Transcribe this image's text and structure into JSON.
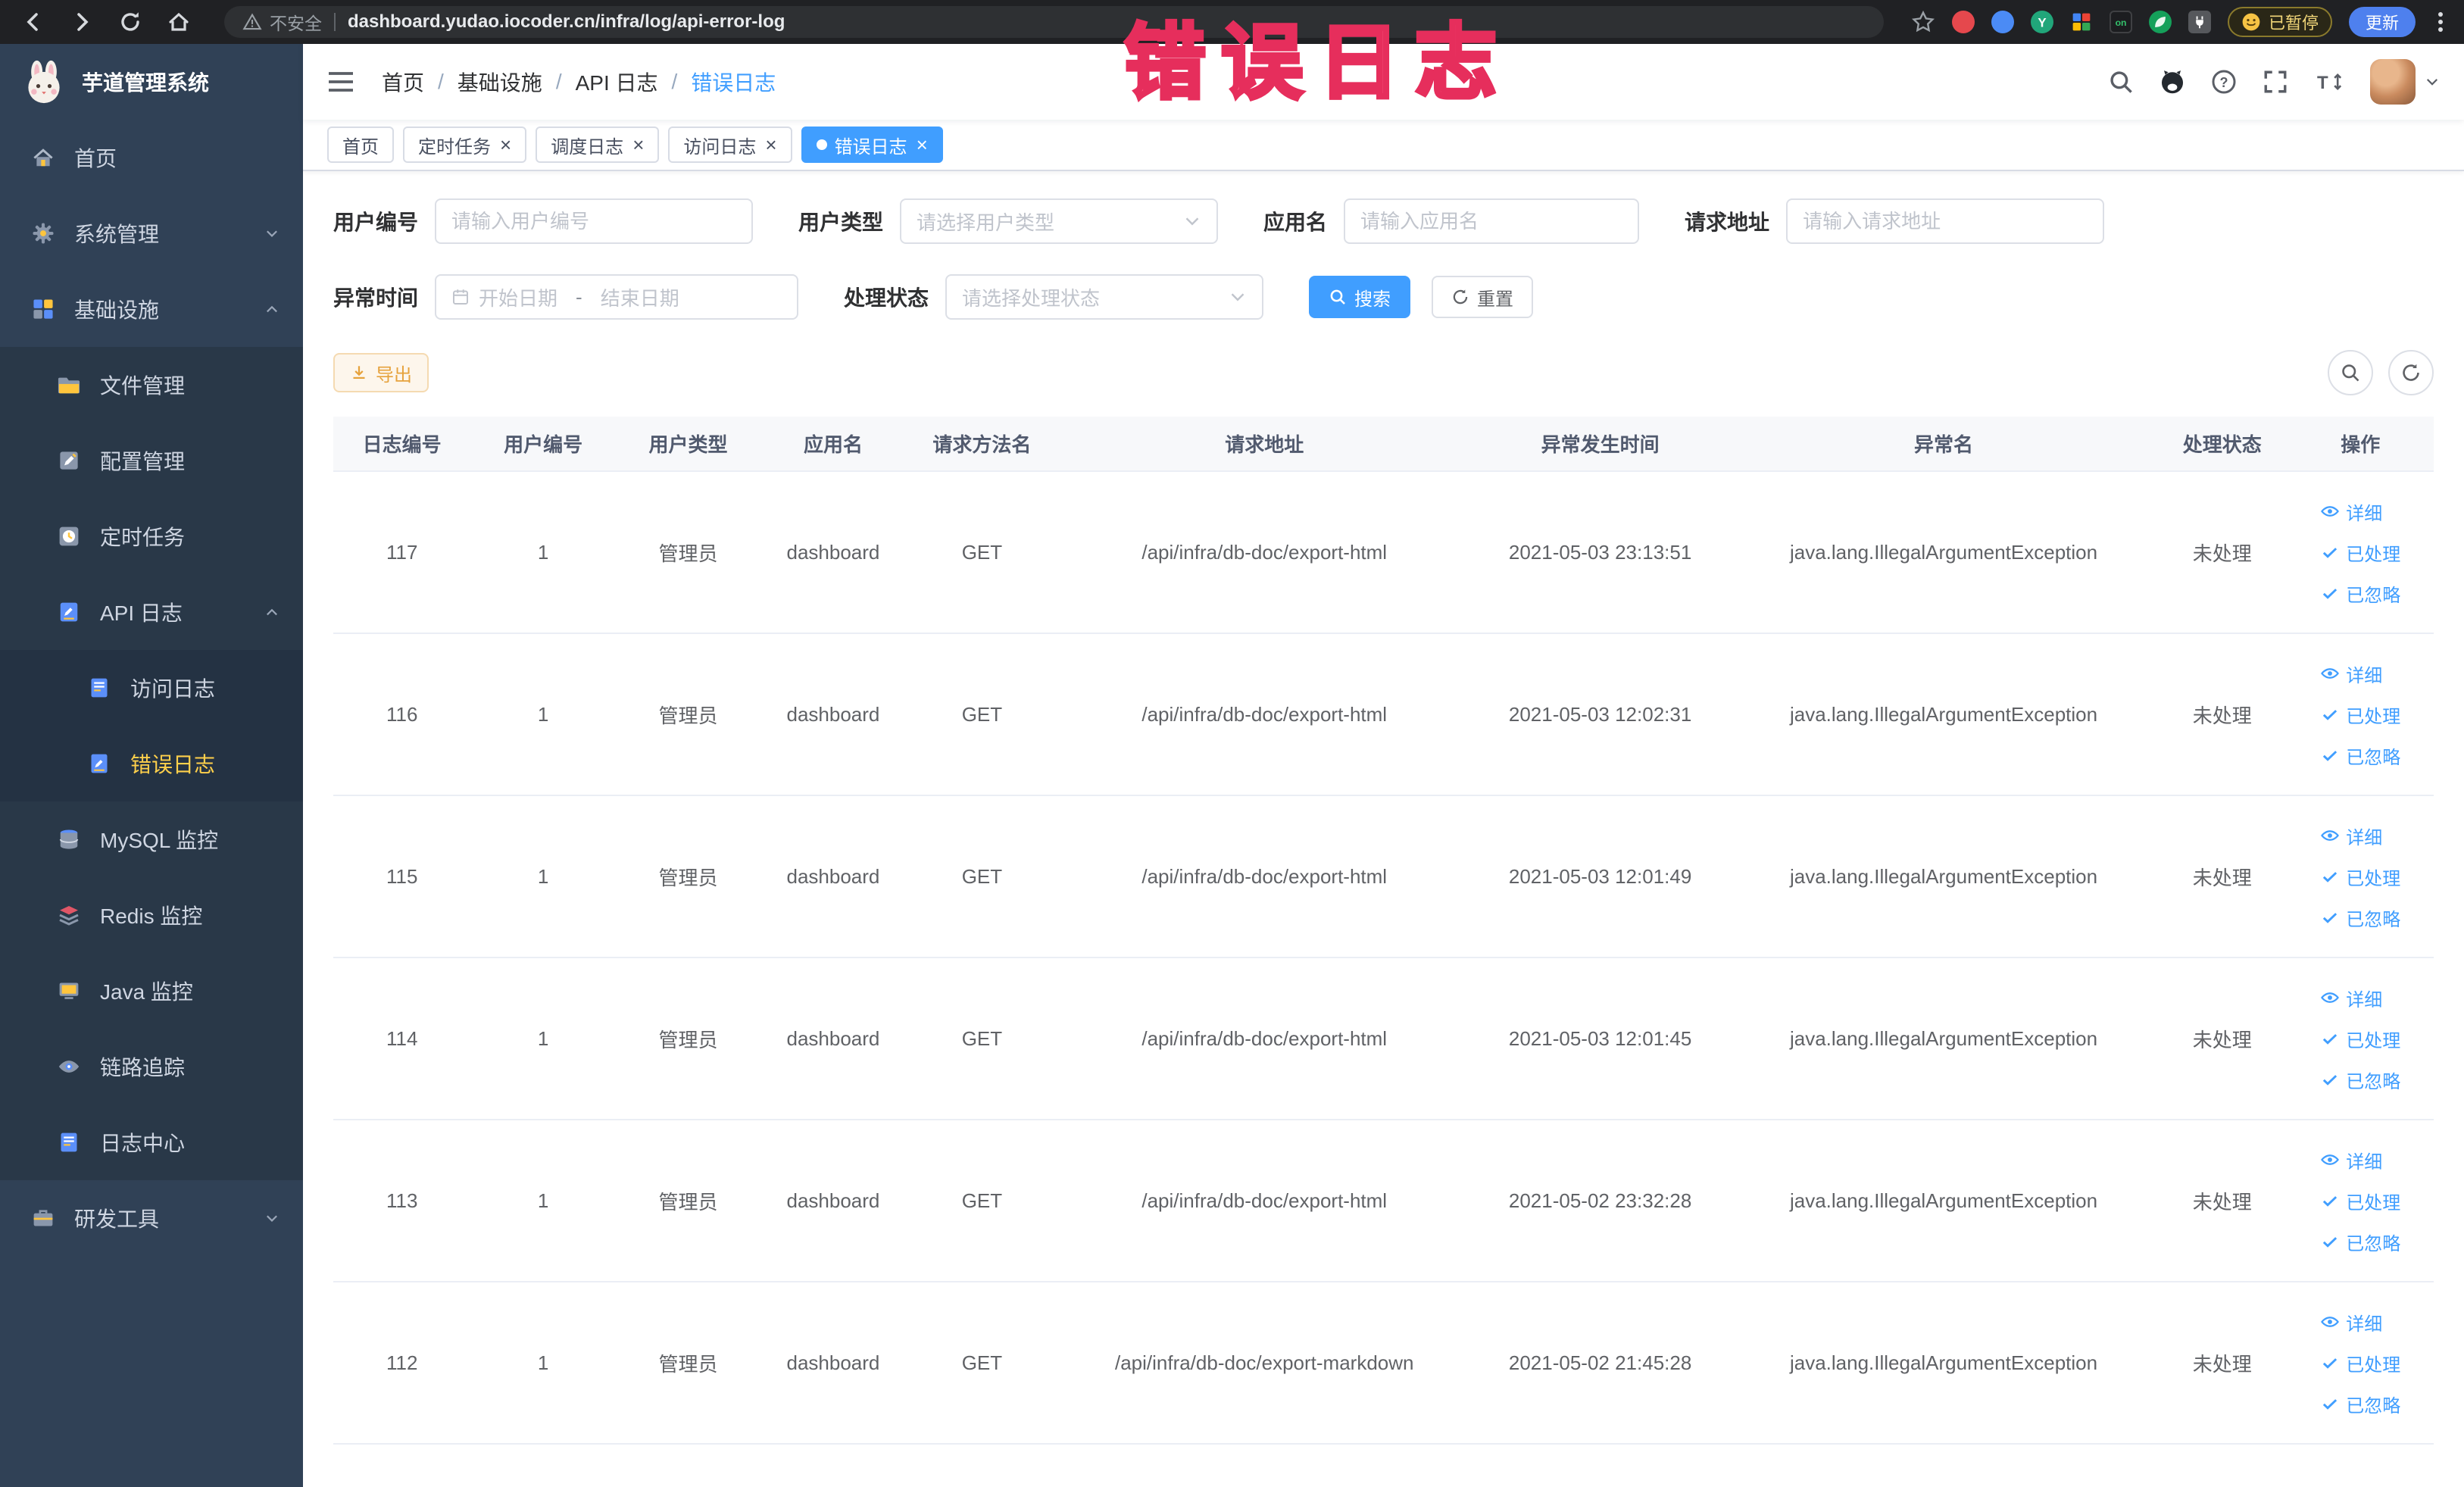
{
  "colors": {
    "accent": "#409eff",
    "sidebar_bg": "#304156",
    "active_menu_text": "#ffd04b",
    "warning": "#e6a23c",
    "annotation_red": "#e62e5c",
    "chrome_bg": "#202124"
  },
  "browser": {
    "security": "不安全",
    "url": "dashboard.yudao.iocoder.cn/infra/log/api-error-log",
    "ext_y": "Y",
    "ext_on": "on",
    "paused": "已暂停",
    "update": "更新"
  },
  "annotation": "错误日志",
  "sidebar": {
    "title": "芋道管理系统",
    "items": [
      {
        "label": "首页"
      },
      {
        "label": "系统管理"
      },
      {
        "label": "基础设施"
      },
      {
        "label": "文件管理"
      },
      {
        "label": "配置管理"
      },
      {
        "label": "定时任务"
      },
      {
        "label": "API 日志"
      },
      {
        "label": "访问日志"
      },
      {
        "label": "错误日志"
      },
      {
        "label": "MySQL 监控"
      },
      {
        "label": "Redis 监控"
      },
      {
        "label": "Java 监控"
      },
      {
        "label": "链路追踪"
      },
      {
        "label": "日志中心"
      },
      {
        "label": "研发工具"
      }
    ]
  },
  "breadcrumb": {
    "items": [
      "首页",
      "基础设施",
      "API 日志",
      "错误日志"
    ]
  },
  "tabs": {
    "items": [
      {
        "key": "home",
        "label": "首页",
        "closable": false,
        "active": false
      },
      {
        "key": "job",
        "label": "定时任务",
        "closable": true,
        "active": false
      },
      {
        "key": "job-log",
        "label": "调度日志",
        "closable": true,
        "active": false
      },
      {
        "key": "access-log",
        "label": "访问日志",
        "closable": true,
        "active": false
      },
      {
        "key": "error-log",
        "label": "错误日志",
        "closable": true,
        "active": true
      }
    ]
  },
  "filters": {
    "user_id": {
      "label": "用户编号",
      "placeholder": "请输入用户编号",
      "value": ""
    },
    "user_type": {
      "label": "用户类型",
      "placeholder": "请选择用户类型"
    },
    "app_name": {
      "label": "应用名",
      "placeholder": "请输入应用名",
      "value": ""
    },
    "request_url": {
      "label": "请求地址",
      "placeholder": "请输入请求地址",
      "value": ""
    },
    "exception_time": {
      "label": "异常时间",
      "start_placeholder": "开始日期",
      "separator": "-",
      "end_placeholder": "结束日期"
    },
    "process_status": {
      "label": "处理状态",
      "placeholder": "请选择处理状态"
    },
    "search_label": "搜索",
    "reset_label": "重置"
  },
  "toolbar": {
    "export_label": "导出"
  },
  "table": {
    "columns": [
      "日志编号",
      "用户编号",
      "用户类型",
      "应用名",
      "请求方法名",
      "请求地址",
      "异常发生时间",
      "异常名",
      "处理状态",
      "操作"
    ],
    "actions": {
      "detail": "详细",
      "processed": "已处理",
      "ignored": "已忽略"
    },
    "rows": [
      {
        "id": "117",
        "user_id": "1",
        "user_type": "管理员",
        "app": "dashboard",
        "method": "GET",
        "url": "/api/infra/db-doc/export-html",
        "time": "2021-05-03 23:13:51",
        "exception": "java.lang.IllegalArgumentException",
        "status": "未处理"
      },
      {
        "id": "116",
        "user_id": "1",
        "user_type": "管理员",
        "app": "dashboard",
        "method": "GET",
        "url": "/api/infra/db-doc/export-html",
        "time": "2021-05-03 12:02:31",
        "exception": "java.lang.IllegalArgumentException",
        "status": "未处理"
      },
      {
        "id": "115",
        "user_id": "1",
        "user_type": "管理员",
        "app": "dashboard",
        "method": "GET",
        "url": "/api/infra/db-doc/export-html",
        "time": "2021-05-03 12:01:49",
        "exception": "java.lang.IllegalArgumentException",
        "status": "未处理"
      },
      {
        "id": "114",
        "user_id": "1",
        "user_type": "管理员",
        "app": "dashboard",
        "method": "GET",
        "url": "/api/infra/db-doc/export-html",
        "time": "2021-05-03 12:01:45",
        "exception": "java.lang.IllegalArgumentException",
        "status": "未处理"
      },
      {
        "id": "113",
        "user_id": "1",
        "user_type": "管理员",
        "app": "dashboard",
        "method": "GET",
        "url": "/api/infra/db-doc/export-html",
        "time": "2021-05-02 23:32:28",
        "exception": "java.lang.IllegalArgumentException",
        "status": "未处理"
      },
      {
        "id": "112",
        "user_id": "1",
        "user_type": "管理员",
        "app": "dashboard",
        "method": "GET",
        "url": "/api/infra/db-doc/export-markdown",
        "time": "2021-05-02 21:45:28",
        "exception": "java.lang.IllegalArgumentException",
        "status": "未处理"
      }
    ]
  }
}
